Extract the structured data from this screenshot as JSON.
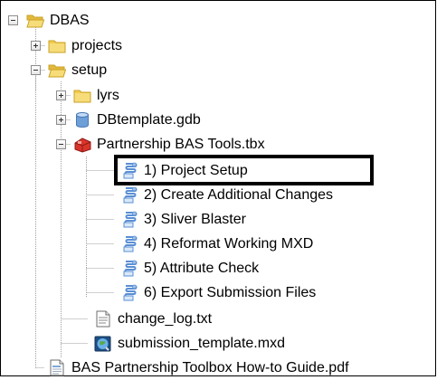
{
  "tree": {
    "root": {
      "label": "DBAS",
      "expanded": true,
      "icon": "folder-open-icon"
    },
    "projects": {
      "label": "projects",
      "expanded": false,
      "icon": "folder-icon"
    },
    "setup": {
      "label": "setup",
      "expanded": true,
      "icon": "folder-open-icon"
    },
    "lyrs": {
      "label": "lyrs",
      "expanded": false,
      "icon": "folder-icon"
    },
    "gdb": {
      "label": "DBtemplate.gdb",
      "expanded": false,
      "icon": "geodatabase-icon"
    },
    "toolbox": {
      "label": "Partnership BAS Tools.tbx",
      "expanded": true,
      "icon": "toolbox-icon"
    },
    "tools": [
      {
        "label": "1) Project Setup",
        "icon": "script-tool-icon"
      },
      {
        "label": "2) Create Additional Changes",
        "icon": "script-tool-icon"
      },
      {
        "label": "3) Sliver Blaster",
        "icon": "script-tool-icon"
      },
      {
        "label": "4) Reformat Working MXD",
        "icon": "script-tool-icon"
      },
      {
        "label": "5) Attribute Check",
        "icon": "script-tool-icon"
      },
      {
        "label": "6) Export Submission Files",
        "icon": "script-tool-icon"
      }
    ],
    "change_log": {
      "label": "change_log.txt",
      "icon": "text-file-icon"
    },
    "template": {
      "label": "submission_template.mxd",
      "icon": "map-document-icon"
    },
    "guide": {
      "label": "BAS Partnership Toolbox How-to Guide.pdf",
      "icon": "pdf-file-icon"
    }
  },
  "highlight": {
    "target": "1) Project Setup",
    "color": "#000000"
  },
  "colors": {
    "folder": "#f2cc4d",
    "folder_border": "#c9a227",
    "toolbox": "#d9342b",
    "script": "#5a8fd4",
    "gdb": "#6e9fd6"
  }
}
